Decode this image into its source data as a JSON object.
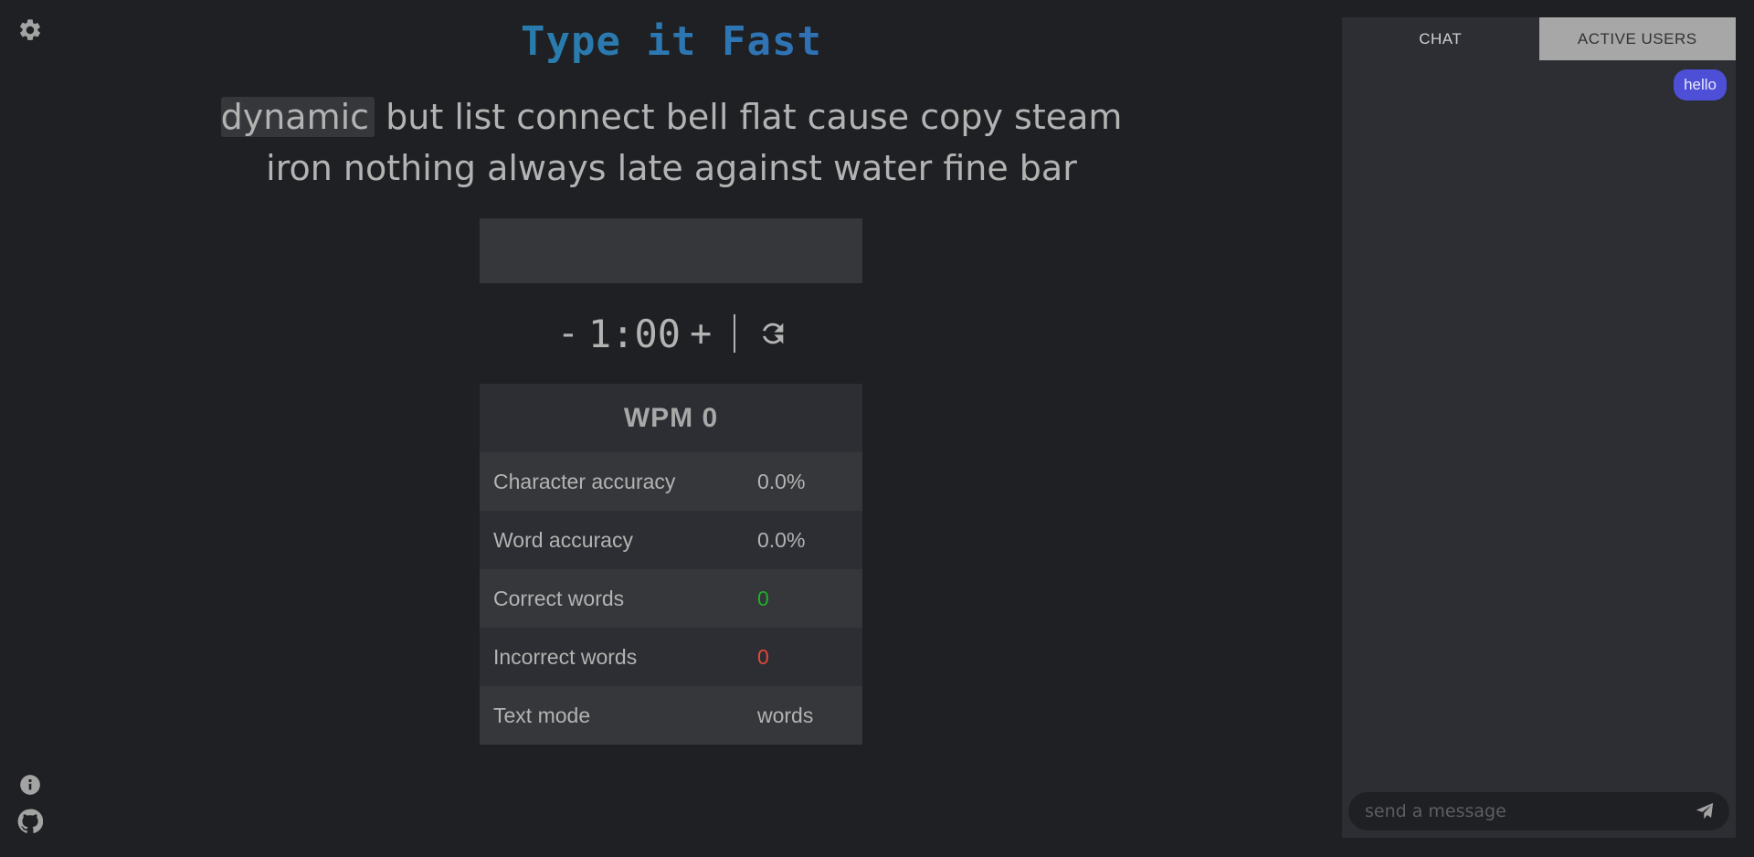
{
  "app": {
    "title": "Type it Fast"
  },
  "icons": {
    "settings": "gear-icon",
    "info": "info-icon",
    "github": "github-icon",
    "reset": "refresh-icon",
    "send": "paper-plane-icon"
  },
  "words": {
    "current": "dynamic",
    "rest_line1": "but list connect bell flat cause copy steam",
    "line2": "iron nothing always late against water fine bar"
  },
  "input": {
    "value": "",
    "placeholder": ""
  },
  "timer": {
    "decrement_label": "-",
    "value": "1:00",
    "increment_label": "+"
  },
  "stats": {
    "header": "WPM 0",
    "rows": [
      {
        "label": "Character accuracy",
        "value": "0.0%"
      },
      {
        "label": "Word accuracy",
        "value": "0.0%"
      },
      {
        "label": "Correct words",
        "value": "0"
      },
      {
        "label": "Incorrect words",
        "value": "0"
      },
      {
        "label": "Text mode",
        "value": "words"
      }
    ]
  },
  "chat": {
    "tabs": [
      {
        "label": "CHAT",
        "active": true
      },
      {
        "label": "ACTIVE USERS",
        "active": false
      }
    ],
    "messages": [
      {
        "text": "hello"
      }
    ],
    "input_placeholder": "send a message"
  },
  "colors": {
    "background": "#1f2023",
    "panel": "#2c2e33",
    "accent_message": "#4d4fd6",
    "correct": "#1fae2a",
    "incorrect": "#e0473a"
  }
}
